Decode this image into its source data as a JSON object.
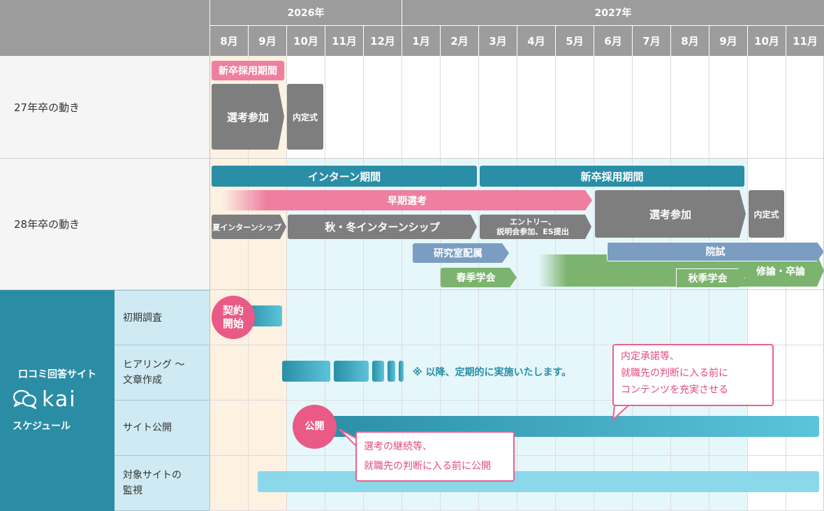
{
  "header": {
    "years": [
      "2026年",
      "2027年"
    ],
    "months": [
      "8月",
      "9月",
      "10月",
      "11月",
      "12月",
      "1月",
      "2月",
      "3月",
      "4月",
      "5月",
      "6月",
      "7月",
      "8月",
      "9月",
      "10月",
      "11月"
    ]
  },
  "rows": {
    "row27": "27年卒の動き",
    "row28": "28年卒の動き"
  },
  "row27": {
    "recruit": "新卒採用期間",
    "selection": "選考参加",
    "offer": "内定式"
  },
  "row28": {
    "intern_period": "インターン期間",
    "recruit_period": "新卒採用期間",
    "early_selection": "早期選考",
    "summer_intern": "夏インターンシップ",
    "autumn_winter_intern": "秋・冬インターンシップ",
    "entry_line1": "エントリー、",
    "entry_line2": "説明会参加、ES提出",
    "selection": "選考参加",
    "offer": "内定式",
    "lab": "研究室配属",
    "spring_conf": "春季学会",
    "grad_school": "院試",
    "autumn_conf": "秋季学会",
    "thesis": "修論・卒論"
  },
  "kai": {
    "title1": "口コミ回答サイト",
    "logo": "kai",
    "title2": "スケジュール",
    "tasks": {
      "survey": "初期調査",
      "hearing1": "ヒアリング 〜",
      "hearing2": "文章作成",
      "publish": "サイト公開",
      "monitor1": "対象サイトの",
      "monitor2": "監視"
    },
    "contract1": "契約",
    "contract2": "開始",
    "note": "※ 以降、定期的に実施いたします。",
    "publish_circle": "公開",
    "callout_top": [
      "内定承諾等、",
      "就職先の判断に入る前に",
      "コンテンツを充実させる"
    ],
    "callout_bottom": [
      "選考の継続等、",
      "就職先の判断に入る前に公開"
    ]
  },
  "colors": {
    "header": "#9c9c9c",
    "teal": "#2a8ea6",
    "pink": "#ee7fa0",
    "grey": "#7e7e7e",
    "blue": "#7b9dc1",
    "green": "#7cb36e",
    "cyan": "#8ad8ea",
    "sidebar": "#2b8da5",
    "highlight_peach": "#fdf1e2",
    "highlight_cyan": "#e6f7fb",
    "accent": "#ea5a87"
  }
}
